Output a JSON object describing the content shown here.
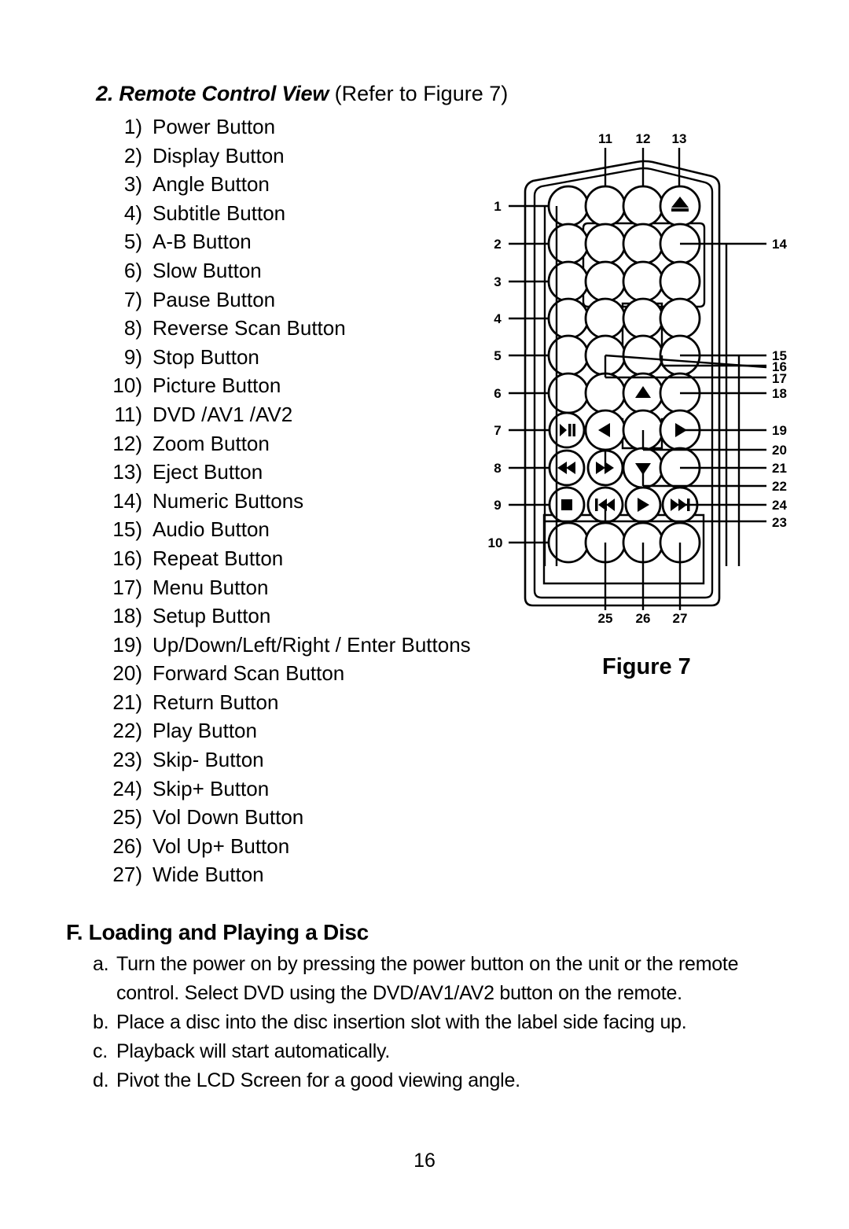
{
  "section": {
    "heading_bold": "2. Remote Control View",
    "heading_plain": " (Refer to Figure 7)"
  },
  "remote_list": [
    {
      "num": "1)",
      "label": "Power Button"
    },
    {
      "num": "2)",
      "label": "Display Button"
    },
    {
      "num": "3)",
      "label": "Angle Button"
    },
    {
      "num": "4)",
      "label": "Subtitle Button"
    },
    {
      "num": "5)",
      "label": "A-B Button"
    },
    {
      "num": "6)",
      "label": "Slow Button"
    },
    {
      "num": "7)",
      "label": "Pause Button"
    },
    {
      "num": "8)",
      "label": "Reverse Scan Button"
    },
    {
      "num": "9)",
      "label": "Stop Button"
    },
    {
      "num": "10)",
      "label": "Picture Button"
    },
    {
      "num": "11)",
      "label": "DVD /AV1 /AV2"
    },
    {
      "num": "12)",
      "label": "Zoom Button"
    },
    {
      "num": "13)",
      "label": "Eject Button"
    },
    {
      "num": "14)",
      "label": "Numeric Buttons"
    },
    {
      "num": "15)",
      "label": "Audio Button"
    },
    {
      "num": "16)",
      "label": "Repeat Button"
    },
    {
      "num": "17)",
      "label": "Menu Button"
    },
    {
      "num": "18)",
      "label": "Setup Button"
    },
    {
      "num": "19)",
      "label": "Up/Down/Left/Right / Enter Buttons"
    },
    {
      "num": "20)",
      "label": "Forward Scan Button"
    },
    {
      "num": "21)",
      "label": "Return Button"
    },
    {
      "num": "22)",
      "label": "Play Button"
    },
    {
      "num": "23)",
      "label": "Skip- Button"
    },
    {
      "num": "24)",
      "label": "Skip+ Button"
    },
    {
      "num": "25)",
      "label": "Vol Down Button"
    },
    {
      "num": "26)",
      "label": "Vol Up+ Button"
    },
    {
      "num": "27)",
      "label": "Wide Button"
    }
  ],
  "figure": {
    "caption": "Figure 7",
    "callouts_left": [
      "1",
      "2",
      "3",
      "4",
      "5",
      "6",
      "7",
      "8",
      "9",
      "10"
    ],
    "callouts_top": [
      "11",
      "12",
      "13"
    ],
    "callouts_right": [
      "14",
      "15",
      "16",
      "17",
      "18",
      "19",
      "20",
      "21",
      "22",
      "24",
      "23"
    ],
    "callouts_bottom": [
      "25",
      "26",
      "27"
    ],
    "button_icons": [
      "eject-icon",
      "pause-icon",
      "rewind-icon",
      "fast-forward-icon",
      "stop-icon",
      "skip-back-icon",
      "play-icon",
      "skip-forward-icon",
      "dpad-up-icon",
      "dpad-down-icon",
      "dpad-left-icon",
      "dpad-right-icon"
    ]
  },
  "section_f": {
    "heading": "F. Loading and Playing a Disc",
    "steps": [
      {
        "marker": "a.",
        "text": "Turn the power on by pressing the power button on the unit or the remote control. Select DVD using the DVD/AV1/AV2 button on the remote."
      },
      {
        "marker": "b.",
        "text": "Place a disc into the disc insertion slot  with the label side facing up."
      },
      {
        "marker": "c.",
        "text": "Playback will start automatically."
      },
      {
        "marker": "d.",
        "text": "Pivot  the LCD Screen for a good viewing angle."
      }
    ]
  },
  "page_number": "16"
}
